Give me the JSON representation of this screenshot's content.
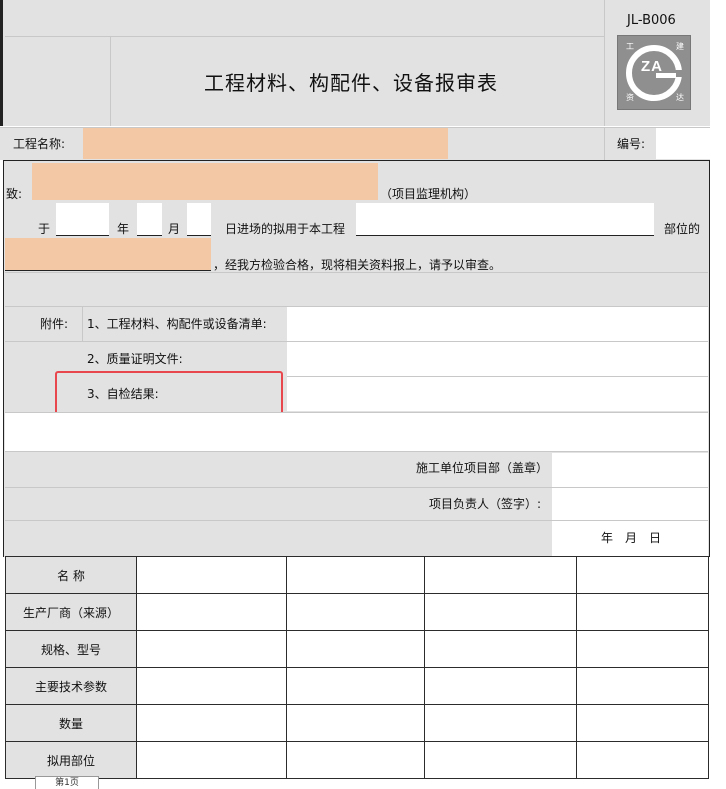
{
  "form": {
    "code": "JL-B006",
    "title": "工程材料、构配件、设备报审表",
    "logo": {
      "letters": "ZA",
      "chars": [
        "工",
        "建",
        "资",
        "达"
      ],
      "icon": "za-logo-icon"
    },
    "project_name_label": "工程名称:",
    "number_label": "编号:",
    "to_label": "致:",
    "supervisor_label": "（项目监理机构）",
    "yu_label": "于",
    "year_label": "年",
    "month_label": "月",
    "entry_text": "日进场的拟用于本工程",
    "location_label": "部位的",
    "inspection_text": "，经我方检验合格，现将相关资料报上，请予以审查。",
    "attachment_label": "附件:",
    "attachment_items": [
      "1、工程材料、构配件或设备清单:",
      "2、质量证明文件:",
      "3、自检结果:"
    ],
    "contractor_dept_label": "施工单位项目部（盖章）",
    "manager_label": "项目负责人（签字）:",
    "date_label": "年　月　日"
  },
  "table": {
    "row_headers": [
      "名 称",
      "生产厂商（来源）",
      "规格、型号",
      "主要技术参数",
      "数量",
      "拟用部位"
    ]
  },
  "sheet_tab": "第1页"
}
